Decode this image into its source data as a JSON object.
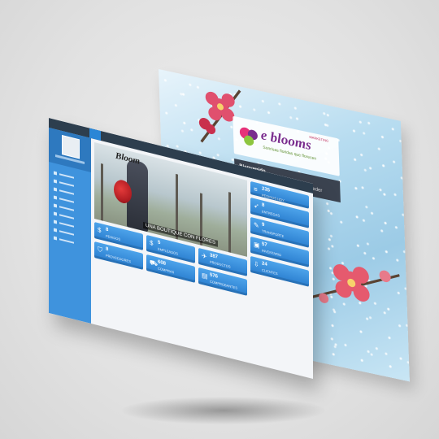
{
  "back_screen": {
    "logo": {
      "brand": "e blooms",
      "subtitle": "Sonrisas floridas que florecen",
      "tag": "MARKETING"
    },
    "login": {
      "title": "Bienvenido",
      "text": "Escribe tus credenciales para acceder"
    }
  },
  "front_screen": {
    "hero": {
      "logo": "Bloom",
      "caption": "UNA BOUTIQUE CON FLORES"
    },
    "right_tiles": [
      {
        "number": "235",
        "label": "PEDIDOS HOY"
      },
      {
        "number": "8",
        "label": "ENTREGAS"
      },
      {
        "number": "9",
        "label": "TRANSPORTE"
      },
      {
        "number": "57",
        "label": "INVENTARIO"
      },
      {
        "number": "24",
        "label": "CLIENTES"
      }
    ],
    "bottom_tiles": [
      {
        "number": "8",
        "label": "PEDIDOS"
      },
      {
        "number": "5",
        "label": "EMPLEADOS"
      },
      {
        "number": "387",
        "label": "PRODUCTOS"
      },
      {
        "number": "8",
        "label": "PROVEEDORES"
      },
      {
        "number": "608",
        "label": "COMPRAS"
      },
      {
        "number": "576",
        "label": "COMPROBANTES"
      }
    ]
  },
  "colors": {
    "tile": "#2b7fd0",
    "sidebar": "#3f93dd",
    "topbar": "#2d3e4e"
  }
}
